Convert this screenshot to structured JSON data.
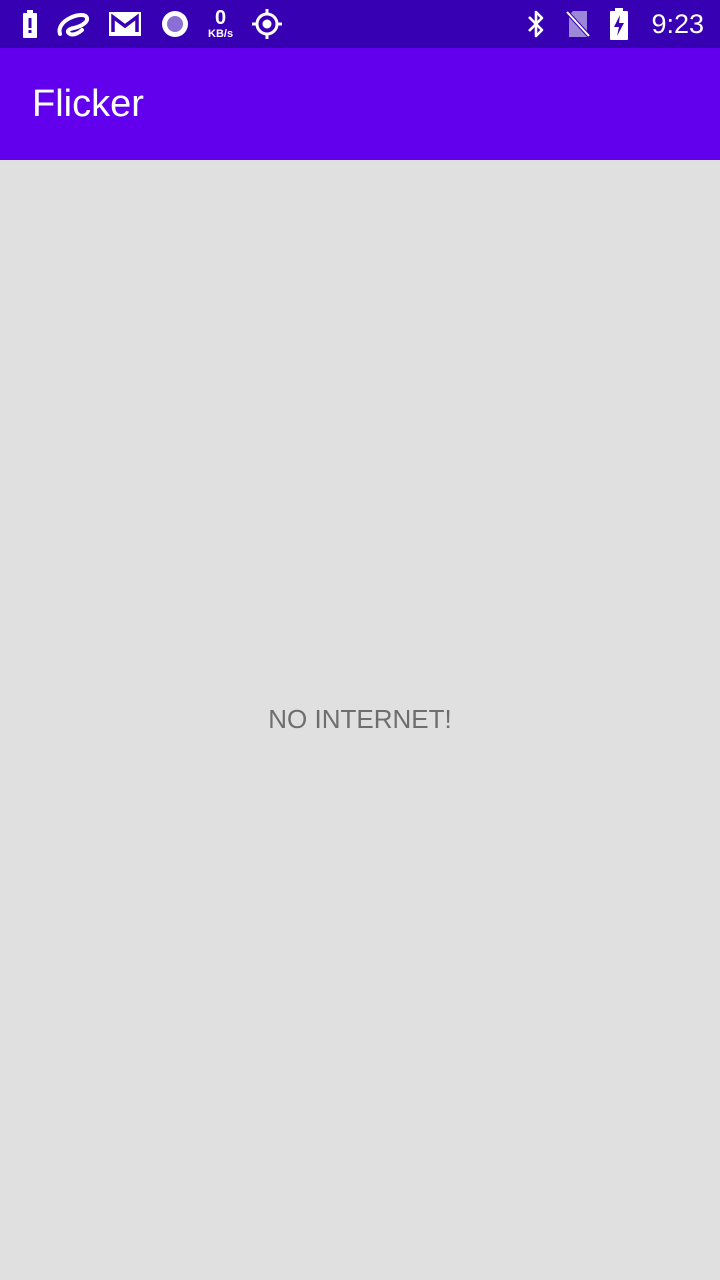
{
  "status_bar": {
    "network_speed_value": "0",
    "network_speed_unit": "KB/s",
    "time": "9:23",
    "left_icons": [
      "battery-alert-icon",
      "airtel-icon",
      "gmail-icon",
      "circle-app-icon",
      "network-speed-icon",
      "location-icon"
    ],
    "right_icons": [
      "bluetooth-icon",
      "no-sim-icon",
      "battery-charging-icon"
    ]
  },
  "app_bar": {
    "title": "Flicker"
  },
  "main": {
    "message": "NO INTERNET!"
  },
  "colors": {
    "status_bar": "#3700B3",
    "app_bar": "#6200EE",
    "background": "#E0E0E0",
    "message_text": "#6E6E6E"
  }
}
